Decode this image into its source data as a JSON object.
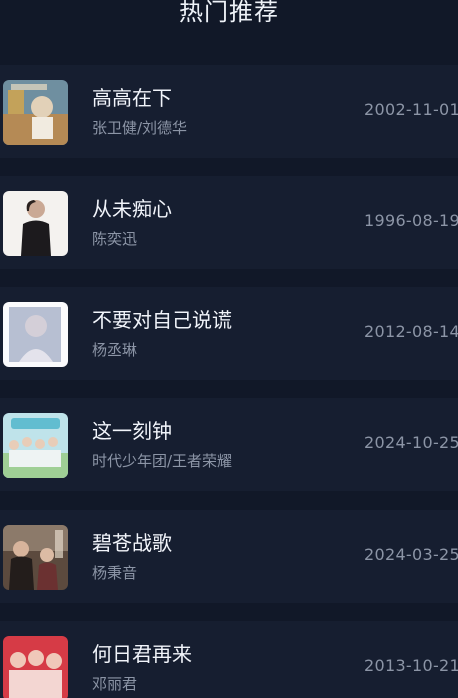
{
  "header": {
    "title": "热门推荐"
  },
  "songs": [
    {
      "title": "高高在下",
      "artist": "张卫健/刘德华",
      "date": "2002-11-01",
      "cover_icon": "album-cover-icon"
    },
    {
      "title": "从未痴心",
      "artist": "陈奕迅",
      "date": "1996-08-19",
      "cover_icon": "album-cover-icon"
    },
    {
      "title": "不要对自己说谎",
      "artist": "杨丞琳",
      "date": "2012-08-14",
      "cover_icon": "album-cover-icon"
    },
    {
      "title": "这一刻钟",
      "artist": "时代少年团/王者荣耀",
      "date": "2024-10-25",
      "cover_icon": "album-cover-icon"
    },
    {
      "title": "碧苍战歌",
      "artist": "杨秉音",
      "date": "2024-03-25",
      "cover_icon": "album-cover-icon"
    },
    {
      "title": "何日君再来",
      "artist": "邓丽君",
      "date": "2013-10-21",
      "cover_icon": "album-cover-icon"
    }
  ],
  "colors": {
    "background": "#111828",
    "row": "#161e30",
    "title_text": "#f1f4fa",
    "secondary_text": "#8c95a6"
  }
}
